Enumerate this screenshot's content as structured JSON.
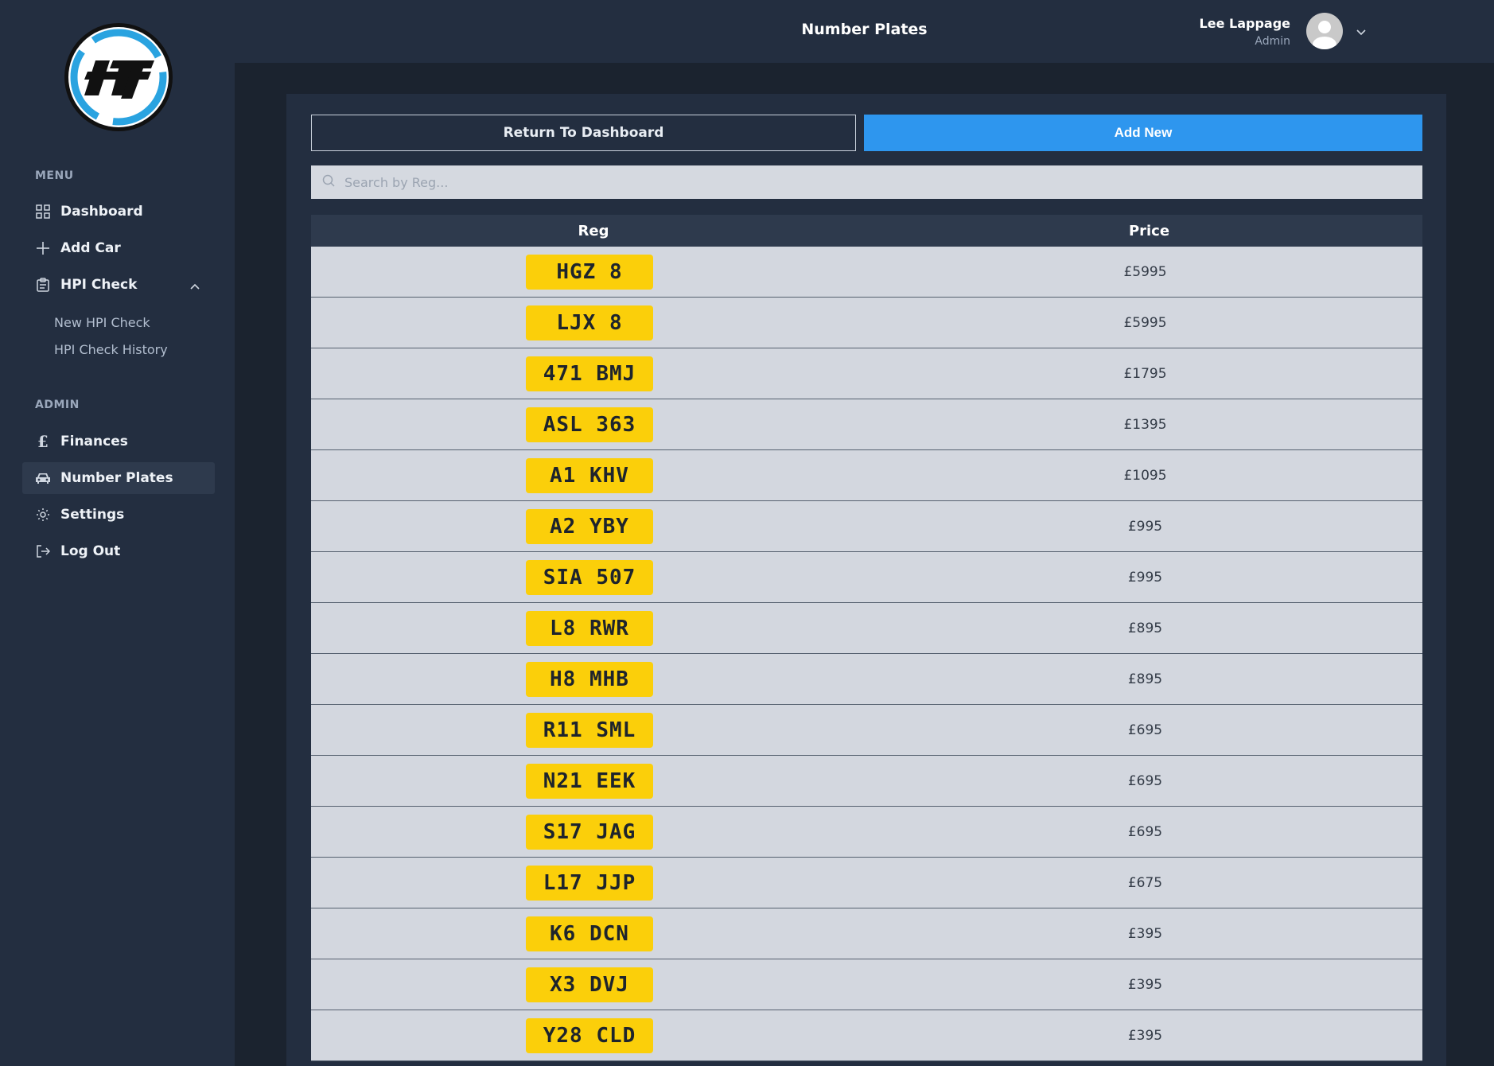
{
  "header": {
    "title": "Number Plates",
    "user_name": "Lee Lappage",
    "user_role": "Admin"
  },
  "sidebar": {
    "menu_title": "MENU",
    "admin_title": "ADMIN",
    "items": [
      {
        "label": "Dashboard",
        "icon": "grid-icon"
      },
      {
        "label": "Add Car",
        "icon": "plus-icon"
      },
      {
        "label": "HPI Check",
        "icon": "clipboard-icon"
      },
      {
        "label": "Finances",
        "icon": "pound-icon"
      },
      {
        "label": "Number Plates",
        "icon": "car-icon"
      },
      {
        "label": "Settings",
        "icon": "gear-icon"
      },
      {
        "label": "Log Out",
        "icon": "logout-icon"
      }
    ],
    "hpi_sub": [
      {
        "label": "New HPI Check"
      },
      {
        "label": "HPI Check History"
      }
    ]
  },
  "actions": {
    "return_label": "Return To Dashboard",
    "add_label": "Add New"
  },
  "search": {
    "placeholder": "Search by Reg..."
  },
  "table": {
    "headers": [
      "Reg",
      "Price"
    ],
    "rows": [
      {
        "reg": "HGZ 8",
        "price": "£5995"
      },
      {
        "reg": "LJX 8",
        "price": "£5995"
      },
      {
        "reg": "471 BMJ",
        "price": "£1795"
      },
      {
        "reg": "ASL 363",
        "price": "£1395"
      },
      {
        "reg": "A1 KHV",
        "price": "£1095"
      },
      {
        "reg": "A2 YBY",
        "price": "£995"
      },
      {
        "reg": "SIA 507",
        "price": "£995"
      },
      {
        "reg": "L8 RWR",
        "price": "£895"
      },
      {
        "reg": "H8 MHB",
        "price": "£895"
      },
      {
        "reg": "R11 SML",
        "price": "£695"
      },
      {
        "reg": "N21 EEK",
        "price": "£695"
      },
      {
        "reg": "S17 JAG",
        "price": "£695"
      },
      {
        "reg": "L17 JJP",
        "price": "£675"
      },
      {
        "reg": "K6 DCN",
        "price": "£395"
      },
      {
        "reg": "X3 DVJ",
        "price": "£395"
      },
      {
        "reg": "Y28 CLD",
        "price": "£395"
      }
    ]
  },
  "colors": {
    "accent": "#2e96ee",
    "plate": "#fbcf0a",
    "sidebar": "#232e40"
  }
}
